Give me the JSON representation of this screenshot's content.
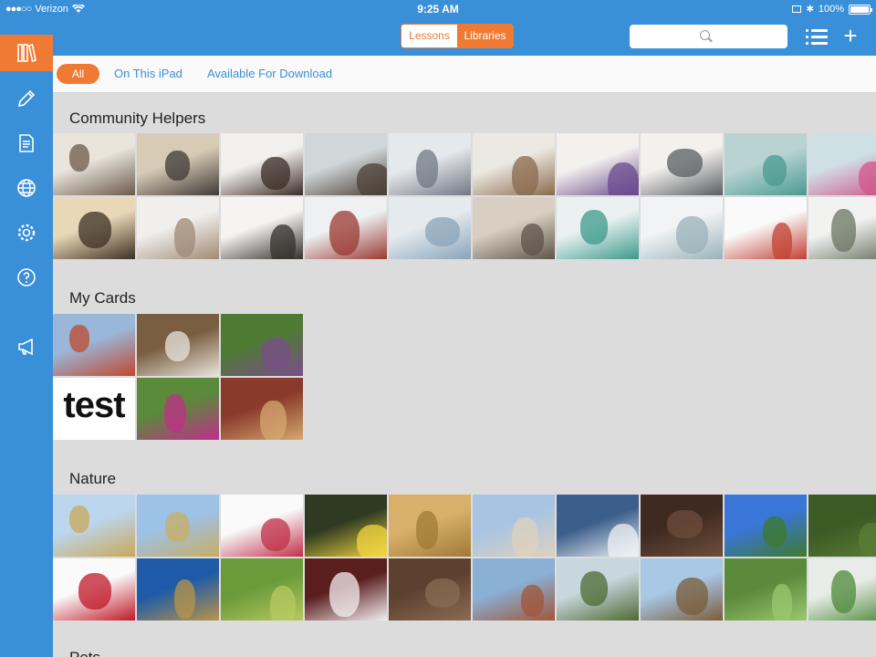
{
  "status": {
    "carrier": "Verizon",
    "time": "9:25 AM",
    "battery": "100%",
    "battery_level": 1.0
  },
  "nav": {
    "segments": [
      {
        "label": "Lessons",
        "active": false
      },
      {
        "label": "Libraries",
        "active": true
      }
    ],
    "search_placeholder": ""
  },
  "sidebar": {
    "items": [
      {
        "icon": "books-icon",
        "active": true
      },
      {
        "icon": "pencil-icon",
        "active": false
      },
      {
        "icon": "notes-icon",
        "active": false
      },
      {
        "icon": "globe-icon",
        "active": false
      },
      {
        "icon": "gear-icon",
        "active": false
      },
      {
        "icon": "help-icon",
        "active": false
      },
      {
        "icon": "megaphone-icon",
        "active": false
      }
    ]
  },
  "filters": {
    "all": "All",
    "on_ipad": "On This iPad",
    "download": "Available For Download"
  },
  "sections": [
    {
      "title": "Community Helpers",
      "tiles": [
        "chef-1",
        "chef-2",
        "hairdresser-1",
        "barber-1",
        "scientist-1",
        "office-worker",
        "doctor-1",
        "doctor-2",
        "dentist-1",
        "dentist-2",
        "hairdresser-2",
        "chef-3",
        "hairdresser-3",
        "barber-2",
        "architect",
        "doctor-3",
        "dentist-3",
        "dentist-4",
        "crossing-guard-1",
        "crossing-guard-2"
      ]
    },
    {
      "title": "My Cards",
      "tiles": [
        "golden-gate-bridge",
        "dog-in-kitchen",
        "woman-outdoors",
        "test",
        "fuchsia-flower",
        "dog-on-rug"
      ],
      "text_tile": "test"
    },
    {
      "title": "Nature",
      "tiles": [
        "hay-bales",
        "wheat-field",
        "potted-flower",
        "yellow-flower",
        "sand-dunes",
        "desert-mountains",
        "snowy-mountain",
        "bark",
        "green-field",
        "grass-1",
        "red-rose",
        "wheat-sky",
        "meadow",
        "lily",
        "soil",
        "monument-valley",
        "plowed-field",
        "plains",
        "grass-2",
        "bush"
      ]
    },
    {
      "title": "Pets",
      "tiles": []
    }
  ],
  "colors": {
    "primary": "#3a8fd9",
    "accent": "#f07a33",
    "background": "#dcdcdd"
  }
}
